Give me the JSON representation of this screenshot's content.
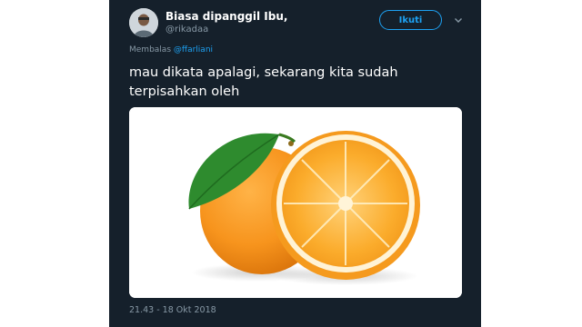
{
  "author": {
    "name": "Biasa dipanggil Ibu,",
    "handle": "@rikadaa"
  },
  "follow_button_label": "Ikuti",
  "reply_to": {
    "prefix": "Membalas",
    "mention": "@ffarliani"
  },
  "tweet_text": "mau dikata apalagi, sekarang kita sudah terpisahkan oleh",
  "timestamp": "21.43 - 18 Okt 2018",
  "icons": {
    "menu": "chevron-down-icon",
    "avatar": "avatar"
  },
  "colors": {
    "background": "#15202b",
    "accent": "#1da1f2",
    "muted_text": "#8899a6",
    "orange": "#f7941d",
    "leaf": "#2e8b2e"
  }
}
